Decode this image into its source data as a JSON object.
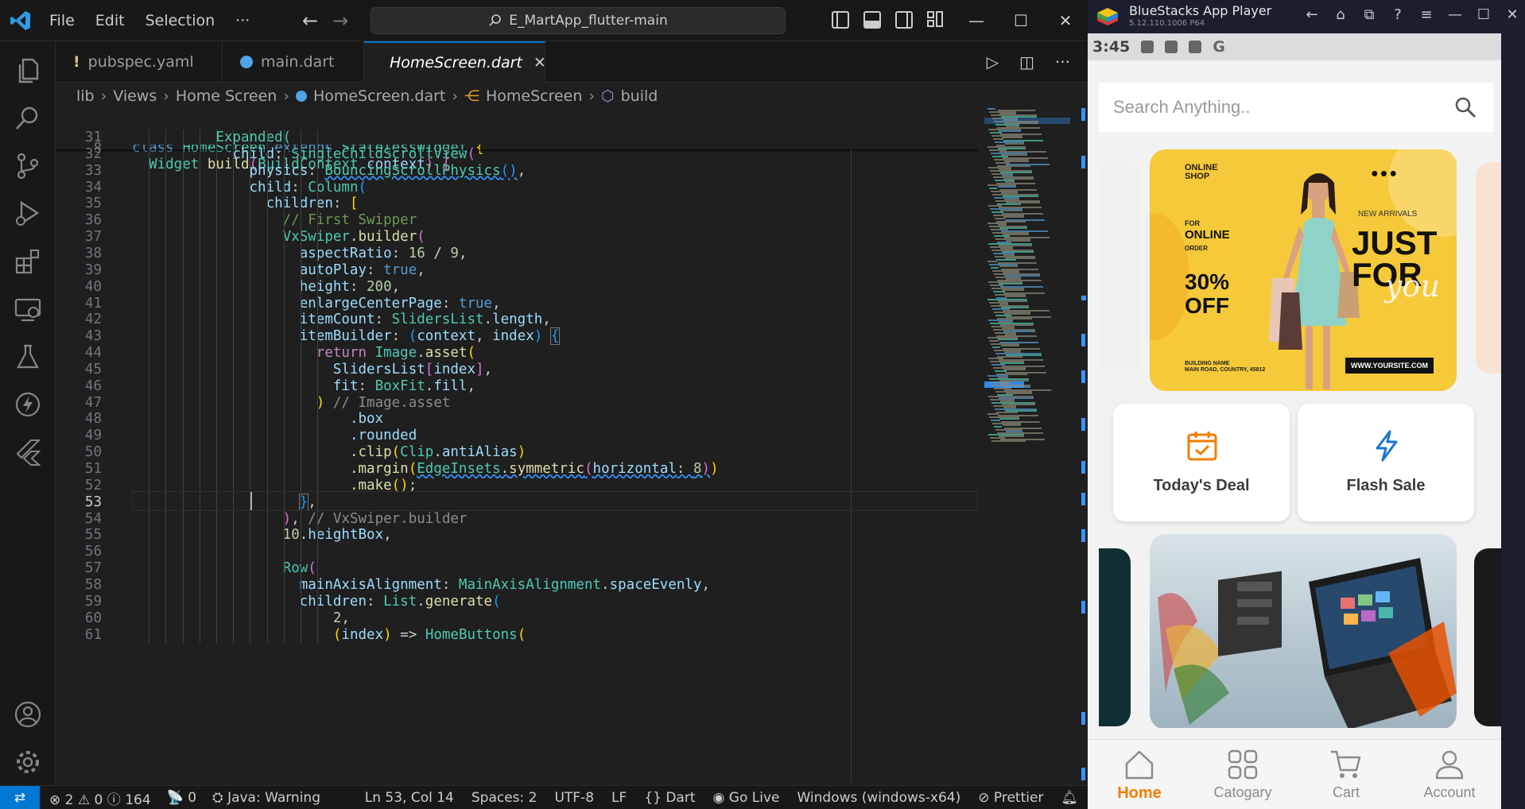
{
  "vscode": {
    "menu": [
      "File",
      "Edit",
      "Selection",
      "···"
    ],
    "search": "E_MartApp_flutter-main",
    "tabs": [
      {
        "label": "pubspec.yaml",
        "icon": "yaml-warning-icon"
      },
      {
        "label": "main.dart",
        "icon": "dart-icon"
      },
      {
        "label": "HomeScreen.dart",
        "icon": "dart-icon",
        "active": true
      }
    ],
    "breadcrumb": [
      "lib",
      "Views",
      "Home Screen",
      "HomeScreen.dart",
      "HomeScreen",
      "build"
    ],
    "sticky": [
      {
        "n": "6",
        "text": "class HomeScreen extends StatelessWidget {"
      },
      {
        "n": "8",
        "text": "  Widget build(BuildContext context) {"
      }
    ],
    "line_numbers": [
      "31",
      "32",
      "33",
      "34",
      "35",
      "36",
      "37",
      "38",
      "39",
      "40",
      "41",
      "42",
      "43",
      "44",
      "45",
      "46",
      "47",
      "48",
      "49",
      "50",
      "51",
      "52",
      "53",
      "54",
      "55",
      "56",
      "57",
      "58",
      "59",
      "60",
      "61"
    ],
    "code": {
      "l31": "Expanded(",
      "l32a": "child",
      "l32b": "SingleChildScrollView",
      "l33a": "physics",
      "l33b": "BouncingScrollPhysics",
      "l34a": "child",
      "l34b": "Column",
      "l35a": "children",
      "l36": "// First Swipper",
      "l37a": "VxSwiper",
      "l37b": "builder",
      "l38a": "aspectRatio",
      "l38b": "16",
      "l38c": "9",
      "l39a": "autoPlay",
      "l39b": "true",
      "l40a": "height",
      "l40b": "200",
      "l41a": "enlargeCenterPage",
      "l41b": "true",
      "l42a": "itemCount",
      "l42b": "SlidersList",
      "l42c": "length",
      "l43a": "itemBuilder",
      "l43b": "context",
      "l43c": "index",
      "l44a": "return",
      "l44b": "Image",
      "l44c": "asset",
      "l45a": "SlidersList",
      "l45b": "index",
      "l46a": "fit",
      "l46b": "BoxFit",
      "l46c": "fill",
      "l47": "// Image.asset",
      "l48": ".box",
      "l49": ".rounded",
      "l50a": ".clip",
      "l50b": "Clip",
      "l50c": "antiAlias",
      "l51a": ".margin",
      "l51b": "EdgeInsets",
      "l51c": "symmetric",
      "l51d": "horizontal",
      "l51e": "8",
      "l52": ".make",
      "l54": "// VxSwiper.builder",
      "l55a": "10",
      "l55b": "heightBox",
      "l57": "Row",
      "l58a": "mainAxisAlignment",
      "l58b": "MainAxisAlignment",
      "l58c": "spaceEvenly",
      "l59a": "children",
      "l59b": "List",
      "l59c": "generate",
      "l60": "2",
      "l61a": "index",
      "l61b": "HomeButtons"
    },
    "status": {
      "errors": "2",
      "warnings": "0",
      "info": "164",
      "ports": "0",
      "java": "Java: Warning",
      "position": "Ln 53, Col 14",
      "spaces": "Spaces: 2",
      "encoding": "UTF-8",
      "eol": "LF",
      "language": "Dart",
      "golive": "Go Live",
      "platform": "Windows (windows-x64)",
      "prettier": "Prettier"
    }
  },
  "bluestacks": {
    "title": "BlueStacks App Player",
    "version": "5.12.110.1006  P64",
    "time": "3:45",
    "app": {
      "search_placeholder": "Search Anything..",
      "banner1": {
        "brand": "ONLINE SHOP",
        "for": "FOR",
        "online": "ONLINE",
        "order": "ORDER",
        "discount_1": "30%",
        "discount_2": "OFF",
        "new_arrivals": "NEW ARRIVALS",
        "just": "JUST",
        "for_word": "FOR",
        "you": "you",
        "address": "BUILDING NAME\nMAIN ROAD, COUNTRY, 45812",
        "site": "WWW.YOURSITE.COM"
      },
      "cards": [
        {
          "label": "Today's Deal",
          "icon": "calendar-check-icon"
        },
        {
          "label": "Flash Sale",
          "icon": "lightning-icon"
        }
      ],
      "nav": [
        {
          "label": "Home",
          "active": true
        },
        {
          "label": "Catogary"
        },
        {
          "label": "Cart"
        },
        {
          "label": "Account"
        }
      ]
    },
    "colors": {
      "accent": "#f57c00",
      "banner_yellow": "#f6c93a",
      "flash_blue": "#1976d2"
    }
  }
}
